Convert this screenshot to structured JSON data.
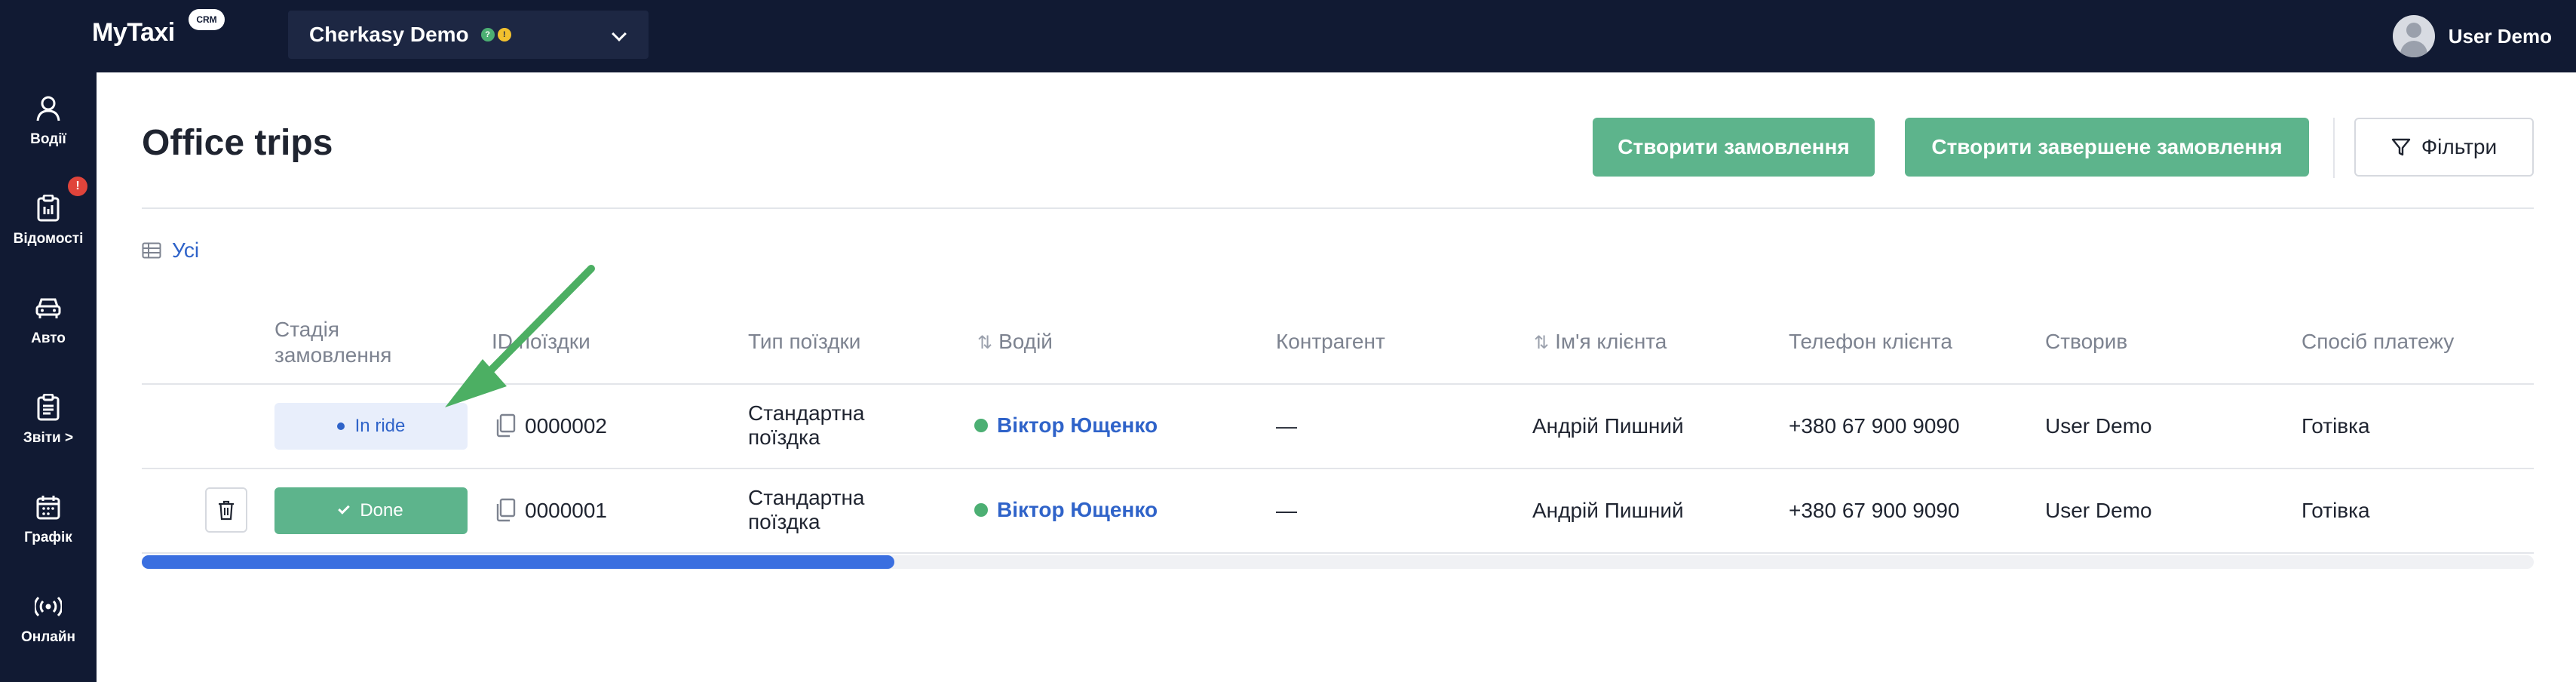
{
  "app": {
    "logo": "MyTaxi",
    "logo_badge": "CRM"
  },
  "city_select": {
    "value": "Cherkasy Demo"
  },
  "user": {
    "name": "User Demo"
  },
  "sidebar": {
    "items": [
      {
        "label": "Водії",
        "icon": "driver-icon"
      },
      {
        "label": "Відомості",
        "icon": "clipboard-icon",
        "badge": "!"
      },
      {
        "label": "Авто",
        "icon": "car-icon"
      },
      {
        "label": "Звіти >",
        "icon": "report-icon"
      },
      {
        "label": "Графік",
        "icon": "calendar-icon"
      },
      {
        "label": "Онлайн",
        "icon": "broadcast-icon"
      }
    ]
  },
  "page": {
    "title": "Office trips"
  },
  "toolbar": {
    "create_order": "Створити замовлення",
    "create_completed_order": "Створити завершене замовлення",
    "filters": "Фільтри"
  },
  "view_tab": {
    "label": "Усі"
  },
  "table": {
    "headers": {
      "stage_line1": "Стадія",
      "stage_line2": "замовлення",
      "trip_id": "ID поїздки",
      "trip_type": "Тип поїздки",
      "driver": "Водій",
      "counterparty": "Контрагент",
      "client_name": "Ім'я клієнта",
      "client_phone": "Телефон клієнта",
      "created_by": "Створив",
      "payment": "Спосіб платежу"
    },
    "rows": [
      {
        "status": "In ride",
        "trip_id": "0000002",
        "trip_type_line1": "Стандартна",
        "trip_type_line2": "поїздка",
        "driver": "Віктор Ющенко",
        "counterparty": "—",
        "client_name": "Андрій Пишний",
        "client_phone": "+380 67 900 9090",
        "created_by": "User Demo",
        "payment": "Готівка"
      },
      {
        "status": "Done",
        "trip_id": "0000001",
        "trip_type_line1": "Стандартна",
        "trip_type_line2": "поїздка",
        "driver": "Віктор Ющенко",
        "counterparty": "—",
        "client_name": "Андрій Пишний",
        "client_phone": "+380 67 900 9090",
        "created_by": "User Demo",
        "payment": "Готівка"
      }
    ]
  },
  "colors": {
    "nav_bg": "#111a33",
    "primary_green": "#5db48c",
    "link_blue": "#2f63c9",
    "scroll_blue": "#3a6fe0",
    "annotation_arrow": "#4caf63"
  },
  "scroll": {
    "position_fraction": 0.31
  }
}
